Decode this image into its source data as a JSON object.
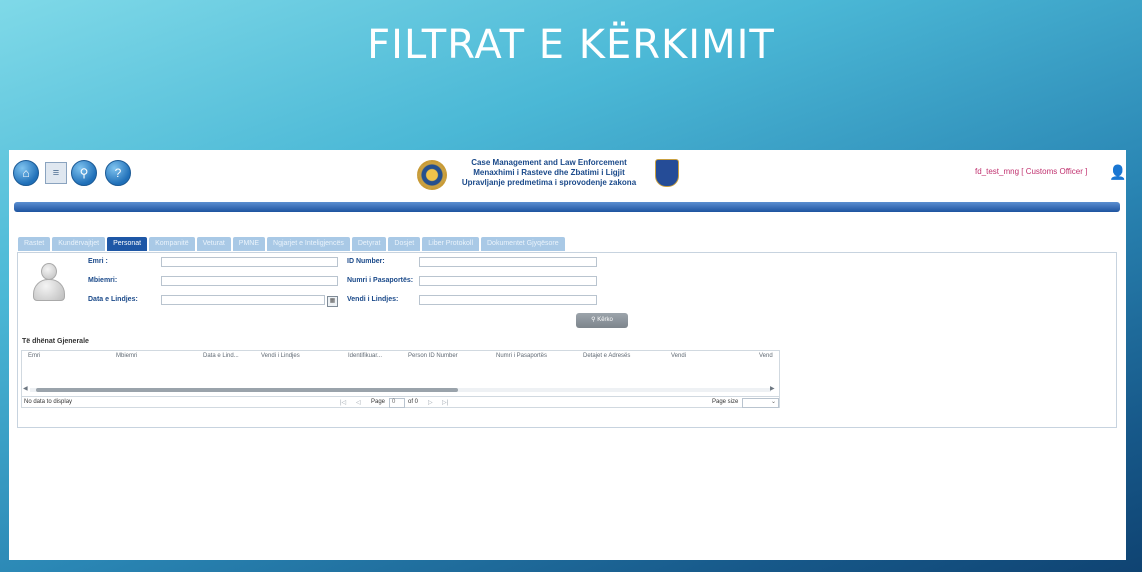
{
  "slide": {
    "title": "FILTRAT E KËRKIMIT"
  },
  "header": {
    "line1": "Case Management and Law Enforcement",
    "line2": "Menaxhimi i Rasteve dhe Zbatimi i Ligjit",
    "line3": "Upravljanje predmetima i sprovodenje zakona",
    "user": "fd_test_mng [ Customs Officer ]"
  },
  "tabs": [
    {
      "label": "Rastet"
    },
    {
      "label": "Kundërvajtjet"
    },
    {
      "label": "Personat"
    },
    {
      "label": "Kompanitë"
    },
    {
      "label": "Veturat"
    },
    {
      "label": "PMNE"
    },
    {
      "label": "Ngjarjet e Inteligjencës"
    },
    {
      "label": "Detyrat"
    },
    {
      "label": "Dosjet"
    },
    {
      "label": "Liber Protokoll"
    },
    {
      "label": "Dokumentet Gjyqësore"
    }
  ],
  "form": {
    "emri_label": "Emri :",
    "mbiemri_label": "Mbiemri:",
    "data_lindjes_label": "Data e Lindjes:",
    "id_number_label": "ID Number:",
    "numri_pasaportes_label": "Numri i Pasaportës:",
    "vendi_lindjes_label": "Vendi i Lindjes:",
    "search_button": "Kërko"
  },
  "section": {
    "title": "Të dhënat Gjenerale"
  },
  "grid": {
    "columns": [
      "Emri",
      "Mbiemri",
      "Data e Lind...",
      "Vendi i Lindjes",
      "Identifikuar...",
      "Person ID Number",
      "Numri i Pasaportës",
      "Detajet e Adresës",
      "Vendi",
      "Vend"
    ],
    "empty_text": "No data to display",
    "page_label": "Page",
    "page_value": "0",
    "of_label": "of 0",
    "page_size_label": "Page size"
  }
}
